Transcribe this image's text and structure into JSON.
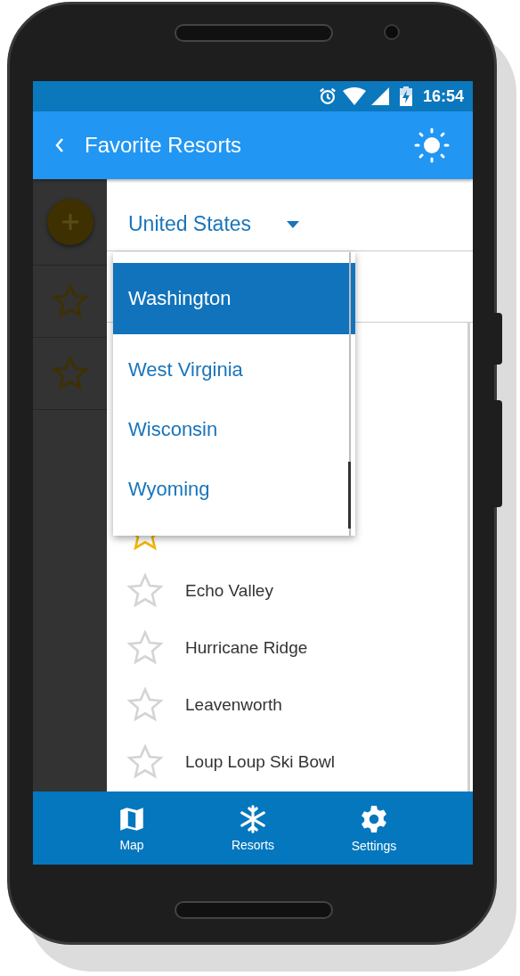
{
  "status_bar": {
    "time": "16:54"
  },
  "app_bar": {
    "title": "Favorite Resorts"
  },
  "country_picker": {
    "value": "United States"
  },
  "state_dropdown": {
    "options": [
      {
        "label": "Washington",
        "selected": true
      },
      {
        "label": "West Virginia",
        "selected": false
      },
      {
        "label": "Wisconsin",
        "selected": false
      },
      {
        "label": "Wyoming",
        "selected": false
      }
    ]
  },
  "resorts": [
    {
      "favorite": true
    },
    {
      "name": "Echo Valley",
      "favorite": false
    },
    {
      "name": "Hurricane Ridge",
      "favorite": false
    },
    {
      "name": "Leavenworth",
      "favorite": false
    },
    {
      "name": "Loup Loup Ski Bowl",
      "favorite": false
    }
  ],
  "bottom_nav": [
    {
      "label": "Map",
      "kind": "map"
    },
    {
      "label": "Resorts",
      "kind": "snow"
    },
    {
      "label": "Settings",
      "kind": "gear"
    }
  ]
}
